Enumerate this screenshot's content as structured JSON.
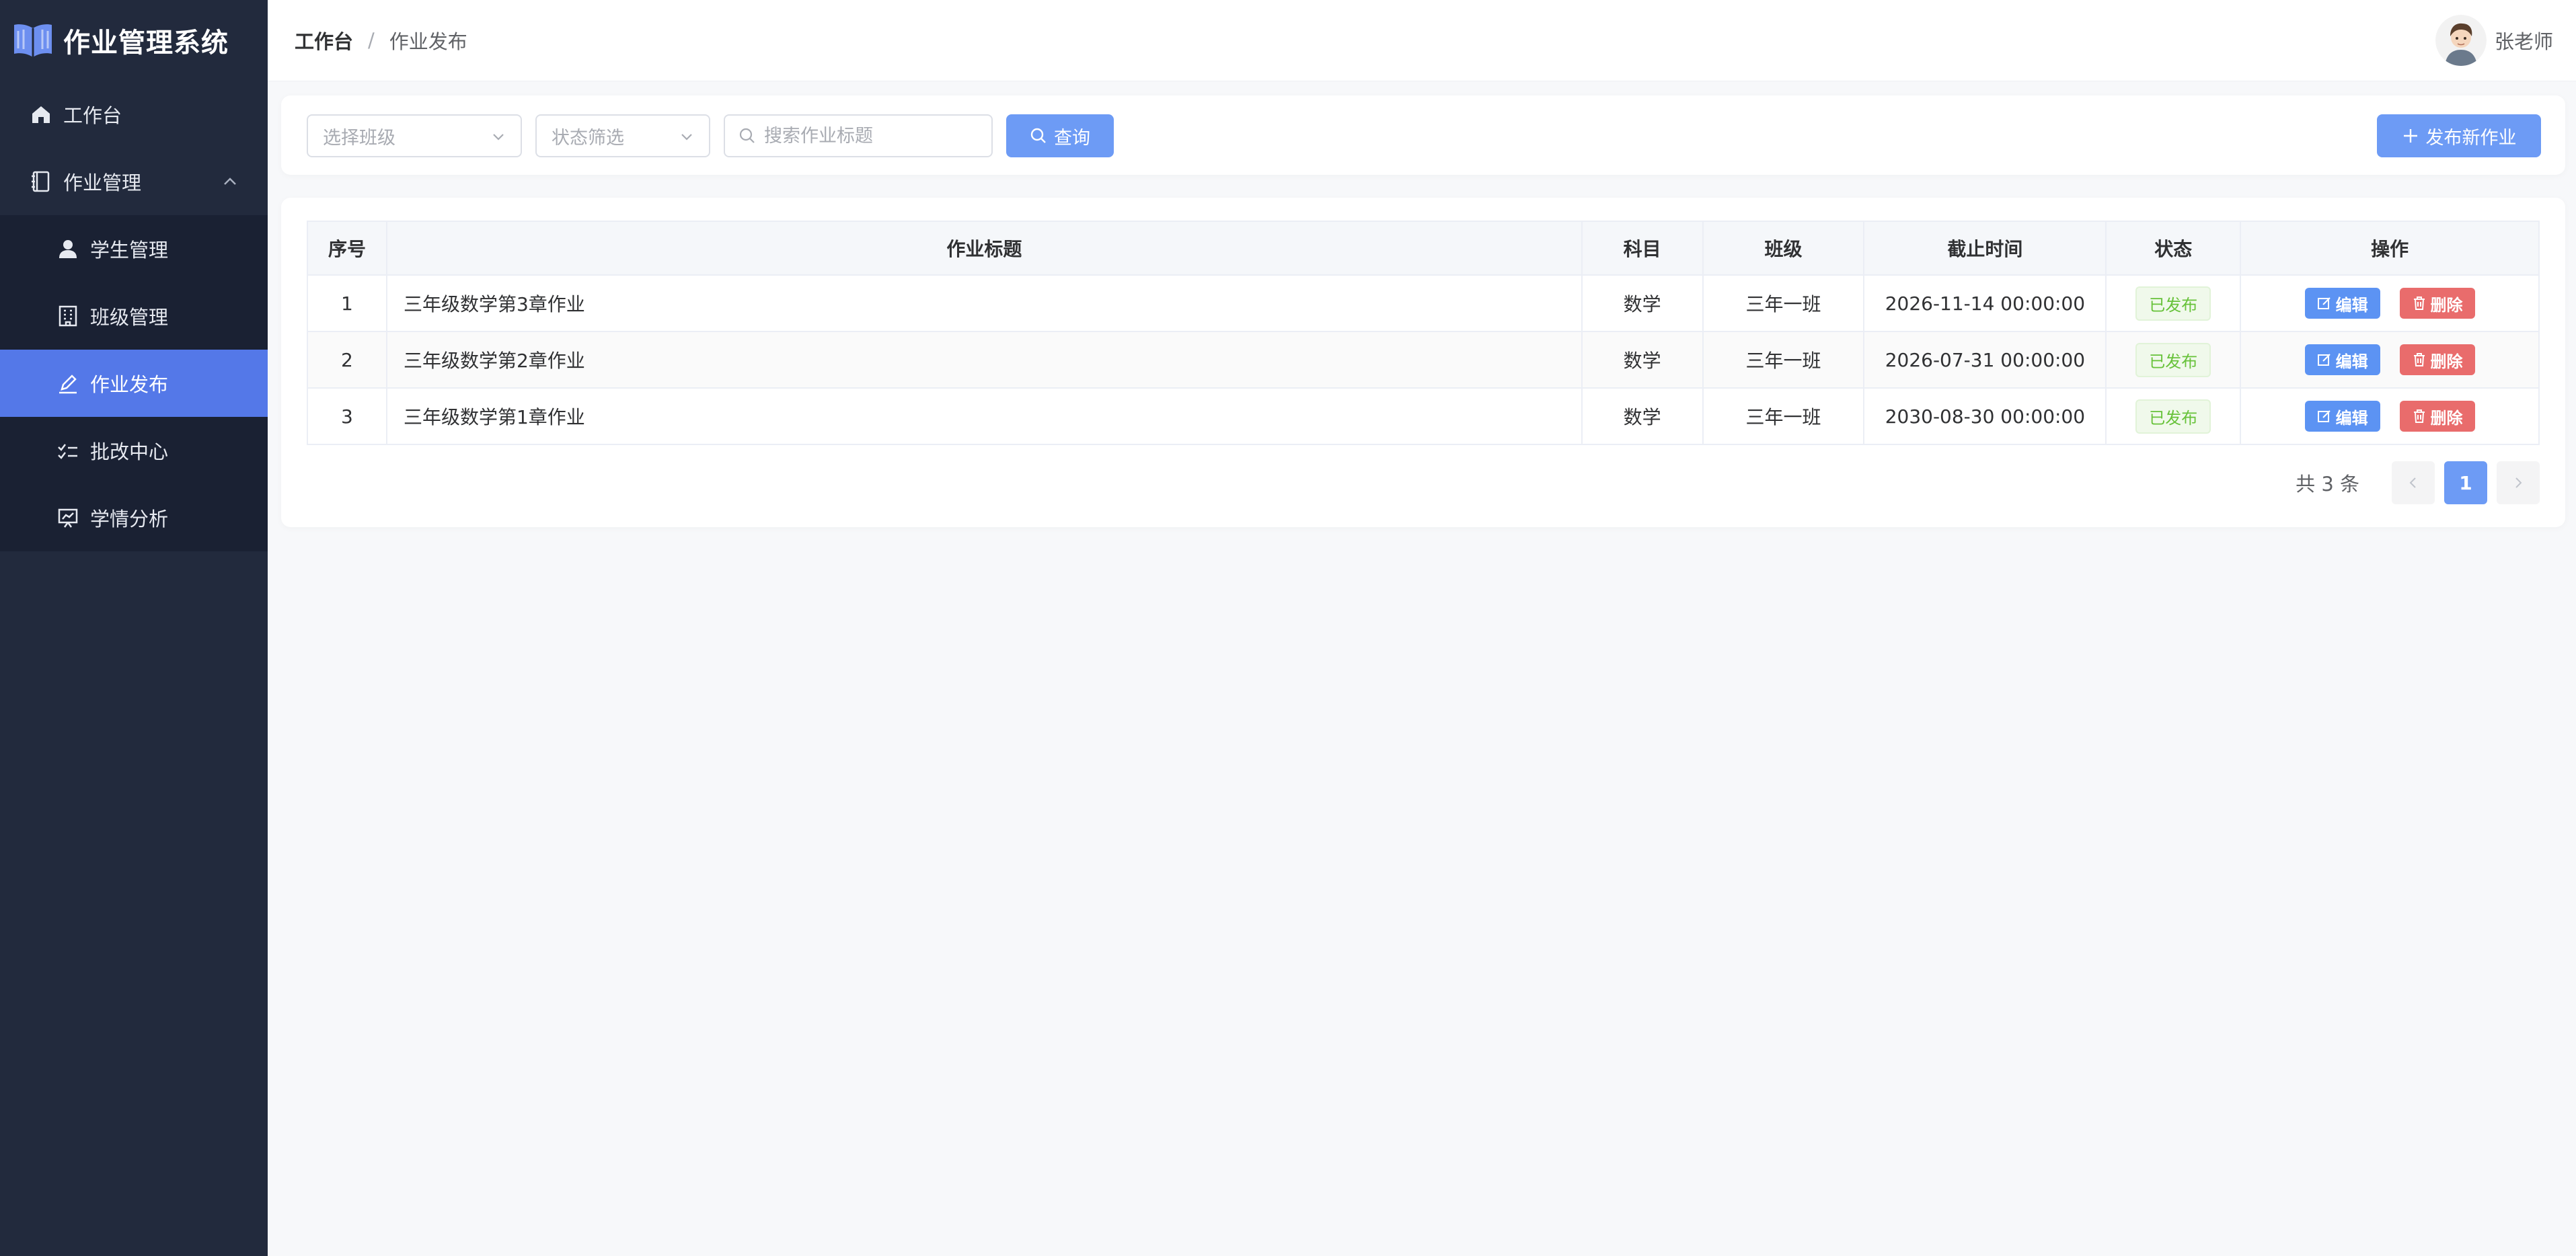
{
  "brand": {
    "title": "作业管理系统",
    "logo_icon": "open-book-icon",
    "accent": "#5478e8"
  },
  "sidebar": {
    "items": [
      {
        "label": "工作台",
        "icon": "home-icon"
      },
      {
        "label": "作业管理",
        "icon": "notebook-icon",
        "expanded": true
      },
      {
        "label": "学生管理",
        "icon": "user-icon"
      },
      {
        "label": "班级管理",
        "icon": "building-icon"
      },
      {
        "label": "作业发布",
        "icon": "edit-pen-icon",
        "active": true
      },
      {
        "label": "批改中心",
        "icon": "checklist-icon"
      },
      {
        "label": "学情分析",
        "icon": "presentation-chart-icon"
      }
    ]
  },
  "header": {
    "breadcrumb": {
      "home": "工作台",
      "separator": "/",
      "current": "作业发布"
    },
    "user": {
      "name": "张老师"
    }
  },
  "filters": {
    "class_select": {
      "placeholder": "选择班级"
    },
    "status_select": {
      "placeholder": "状态筛选"
    },
    "search": {
      "placeholder": "搜索作业标题",
      "value": ""
    },
    "query_label": "查询",
    "publish_label": "发布新作业"
  },
  "table": {
    "columns": [
      "序号",
      "作业标题",
      "科目",
      "班级",
      "截止时间",
      "状态",
      "操作"
    ],
    "rows": [
      {
        "index": "1",
        "title": "三年级数学第3章作业",
        "subject": "数学",
        "class": "三年一班",
        "deadline": "2026-11-14 00:00:00",
        "status": "已发布"
      },
      {
        "index": "2",
        "title": "三年级数学第2章作业",
        "subject": "数学",
        "class": "三年一班",
        "deadline": "2026-07-31 00:00:00",
        "status": "已发布"
      },
      {
        "index": "3",
        "title": "三年级数学第1章作业",
        "subject": "数学",
        "class": "三年一班",
        "deadline": "2030-08-30 00:00:00",
        "status": "已发布"
      }
    ],
    "actions": {
      "edit": "编辑",
      "delete": "删除"
    }
  },
  "pagination": {
    "total_text": "共 3 条",
    "current_page": "1"
  },
  "colors": {
    "primary": "#6d9bf5",
    "danger": "#e96c6c",
    "success": "#67c23a",
    "sidebar_bg": "#222a3d"
  }
}
